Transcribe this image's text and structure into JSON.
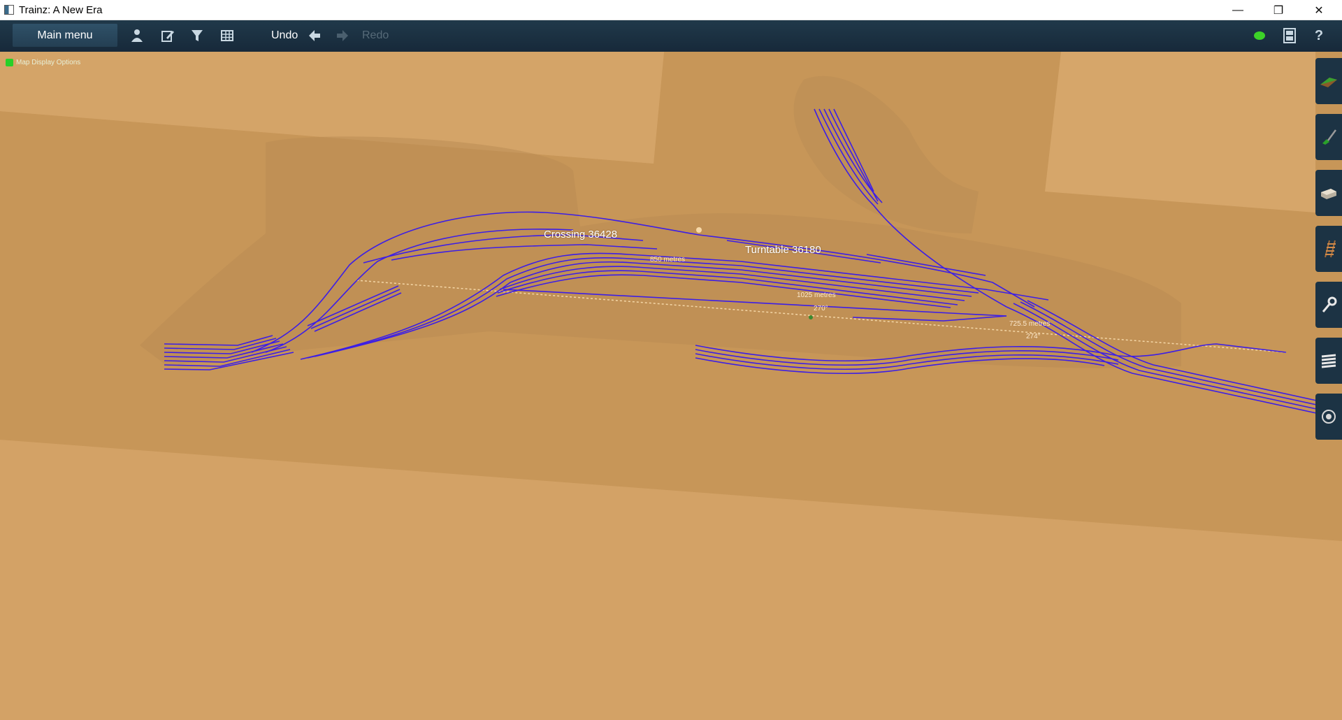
{
  "window": {
    "title": "Trainz: A New Era",
    "controls": {
      "minimize": "—",
      "restore": "❐",
      "close": "✕"
    }
  },
  "toolbar": {
    "main_menu": "Main menu",
    "undo": "Undo",
    "redo": "Redo",
    "icons": [
      "driver-icon",
      "edit-icon",
      "filter-icon",
      "grid-icon"
    ],
    "right_icons": [
      "status-dot-icon",
      "film-icon",
      "help-icon"
    ],
    "help_glyph": "?"
  },
  "map": {
    "options_label": "Map Display Options",
    "labels": {
      "crossing": "Crossing 36428",
      "turntable": "Turntable 36180",
      "measure1": "725.5 metres",
      "angle1": "274°",
      "angle2": "270°",
      "measure2": "1025 metres",
      "measure3": "850 metres"
    }
  },
  "side_toolbar": [
    "terrain-tool-icon",
    "paint-tool-icon",
    "objects-tool-icon",
    "track-tool-icon",
    "tools-icon",
    "layers-icon",
    "settings-icon"
  ],
  "colors": {
    "terrain": "#d2a064",
    "track": "#3c1ee6",
    "toolbar": "#1b3142",
    "status_dot": "#3cd228"
  }
}
